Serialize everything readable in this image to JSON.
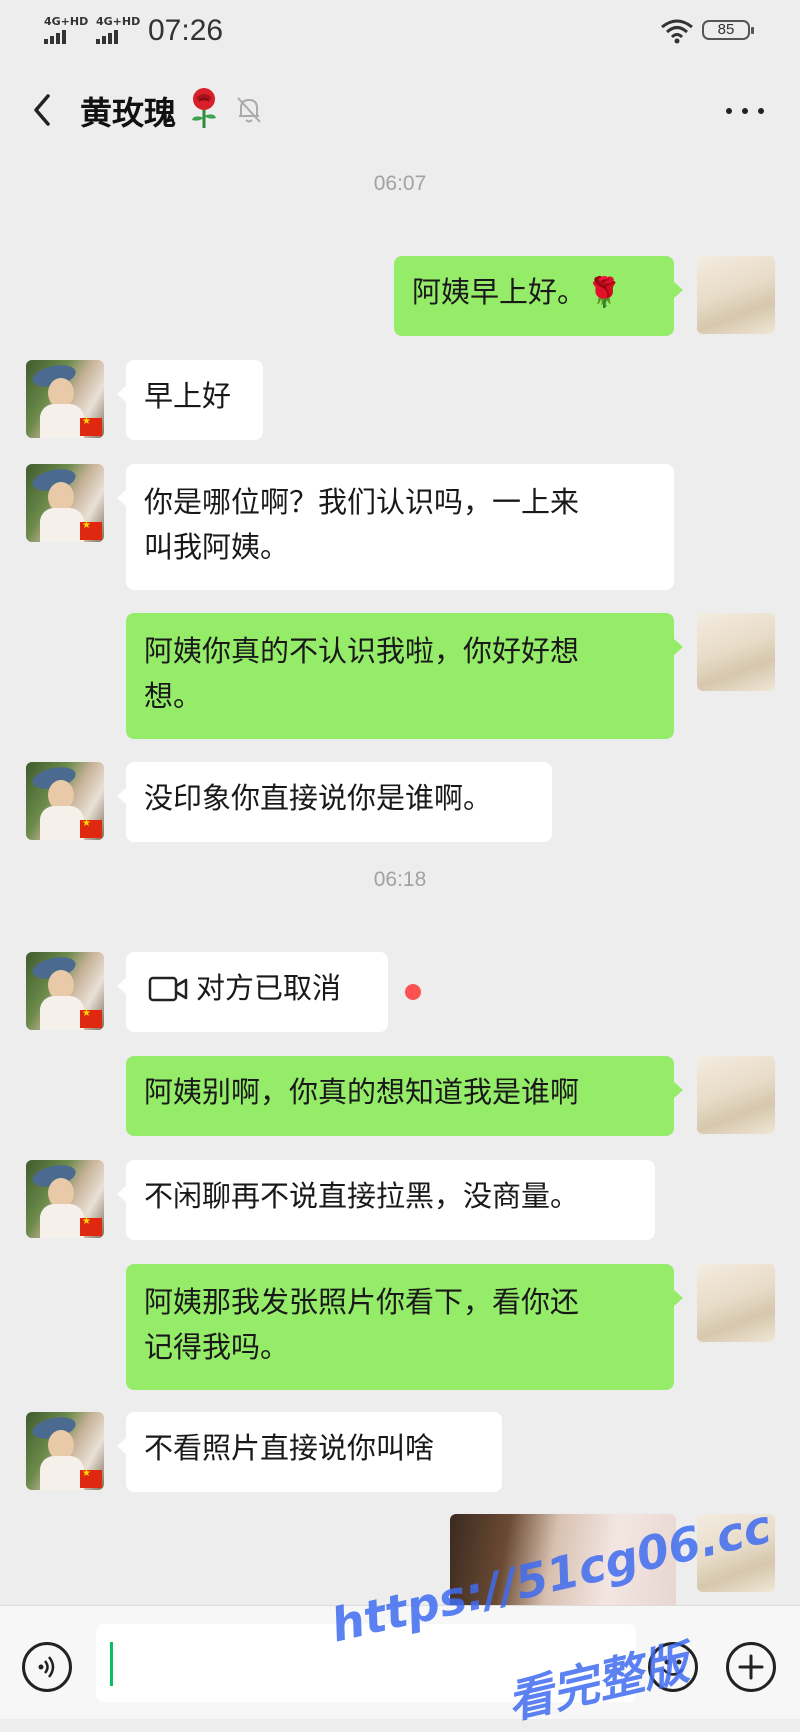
{
  "status_bar": {
    "signal_1": "4G+HD",
    "signal_2": "4G+HD",
    "time": "07:26",
    "battery": "85"
  },
  "header": {
    "title": "黄玫瑰",
    "title_emoji": "rose-icon",
    "mute_icon": "bell-off-icon",
    "more_icon": "more-dots-icon"
  },
  "messages": [
    {
      "type": "timestamp",
      "text": "06:07"
    },
    {
      "from": "self",
      "text": "阿姨早上好。🌹"
    },
    {
      "from": "other",
      "text": "早上好"
    },
    {
      "from": "other",
      "line1": "你是哪位啊？我们认识吗，一上来",
      "line2": "叫我阿姨。"
    },
    {
      "from": "self",
      "line1": "阿姨你真的不认识我啦，你好好想",
      "line2": "想。"
    },
    {
      "from": "other",
      "text": "没印象你直接说你是谁啊。"
    },
    {
      "type": "timestamp",
      "text": "06:18"
    },
    {
      "from": "other",
      "type": "video_call",
      "text": "对方已取消",
      "icon": "video-camera-icon"
    },
    {
      "from": "self",
      "text": "阿姨别啊，你真的想知道我是谁啊"
    },
    {
      "from": "other",
      "text": "不闲聊再不说直接拉黑，没商量。"
    },
    {
      "from": "self",
      "line1": "阿姨那我发张照片你看下，看你还",
      "line2": "记得我吗。"
    },
    {
      "from": "other",
      "text": "不看照片直接说你叫啥"
    },
    {
      "from": "self",
      "type": "image"
    }
  ],
  "input_bar": {
    "voice_icon": "voice-icon",
    "emoji_icon": "emoji-icon",
    "plus_icon": "plus-icon"
  },
  "watermark": {
    "url": "https://51cg06.cc",
    "caption": "看完整版"
  },
  "colors": {
    "background": "#ededed",
    "self_bubble": "#95ec69",
    "other_bubble": "#ffffff",
    "accent": "#07c160",
    "unread_dot": "#fa5151",
    "watermark": "#3f6cf0"
  }
}
